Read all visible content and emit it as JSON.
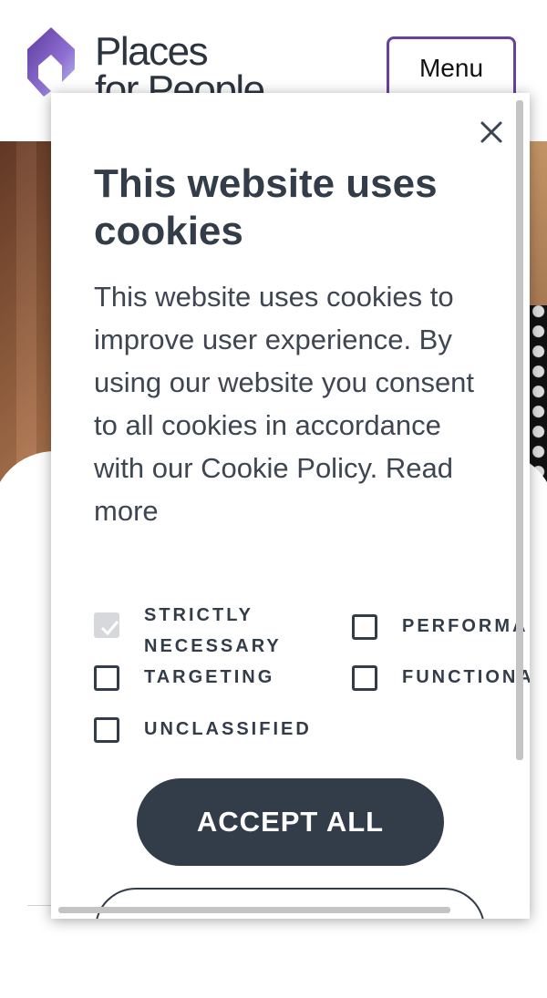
{
  "header": {
    "logo_text": "Places\nfor People",
    "menu_label": "Menu"
  },
  "cookie_modal": {
    "close_icon": "close-icon",
    "title": "This website uses cookies",
    "description": "This website uses cookies to improve user experience. By using our website you consent to all cookies in accordance with our Cookie Policy. Read more",
    "categories": [
      {
        "label": "STRICTLY\nNECESSARY",
        "checked": true,
        "disabled": true
      },
      {
        "label": "PERFORMA",
        "checked": false
      },
      {
        "label": "TARGETING",
        "checked": false
      },
      {
        "label": "FUNCTIONA",
        "checked": false
      },
      {
        "label": "UNCLASSIFIED",
        "checked": false
      }
    ],
    "accept_label": "ACCEPT ALL"
  },
  "colors": {
    "brand_purple": "#6b3fa0",
    "dark_slate": "#333d49"
  }
}
